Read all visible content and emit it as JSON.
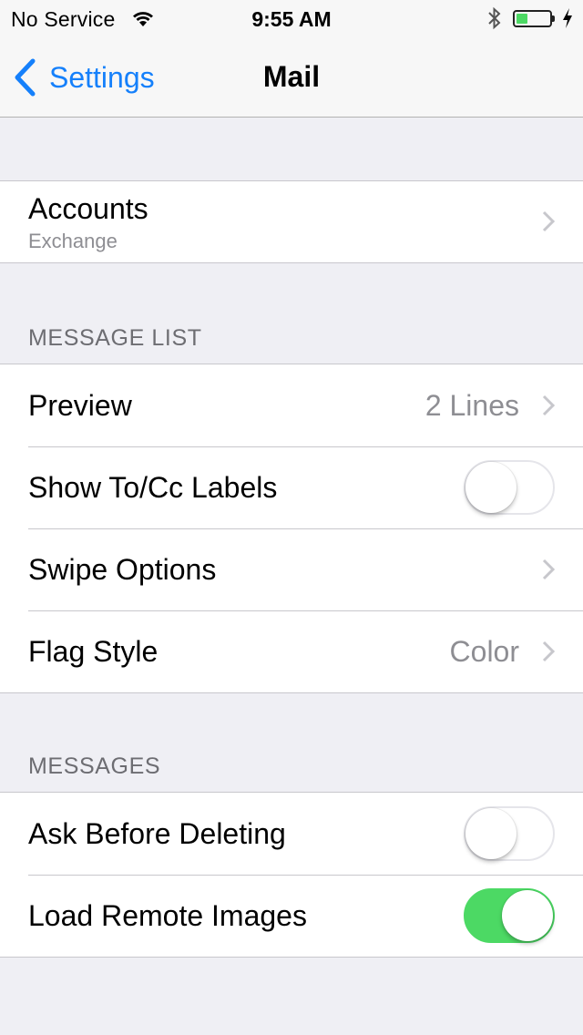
{
  "status_bar": {
    "carrier": "No Service",
    "time": "9:55 AM",
    "battery_level": 0.35,
    "charging": true
  },
  "nav": {
    "back_label": "Settings",
    "title": "Mail"
  },
  "accounts": {
    "label": "Accounts",
    "subtitle": "Exchange"
  },
  "message_list": {
    "header": "MESSAGE LIST",
    "rows": [
      {
        "label": "Preview",
        "value": "2 Lines"
      },
      {
        "label": "Show To/Cc Labels",
        "toggle": false
      },
      {
        "label": "Swipe Options"
      },
      {
        "label": "Flag Style",
        "value": "Color"
      }
    ]
  },
  "messages": {
    "header": "MESSAGES",
    "rows": [
      {
        "label": "Ask Before Deleting",
        "toggle": false
      },
      {
        "label": "Load Remote Images",
        "toggle": true
      }
    ]
  },
  "colors": {
    "accent": "#1580fb",
    "toggle_on": "#4cd964",
    "background": "#efeff4"
  }
}
